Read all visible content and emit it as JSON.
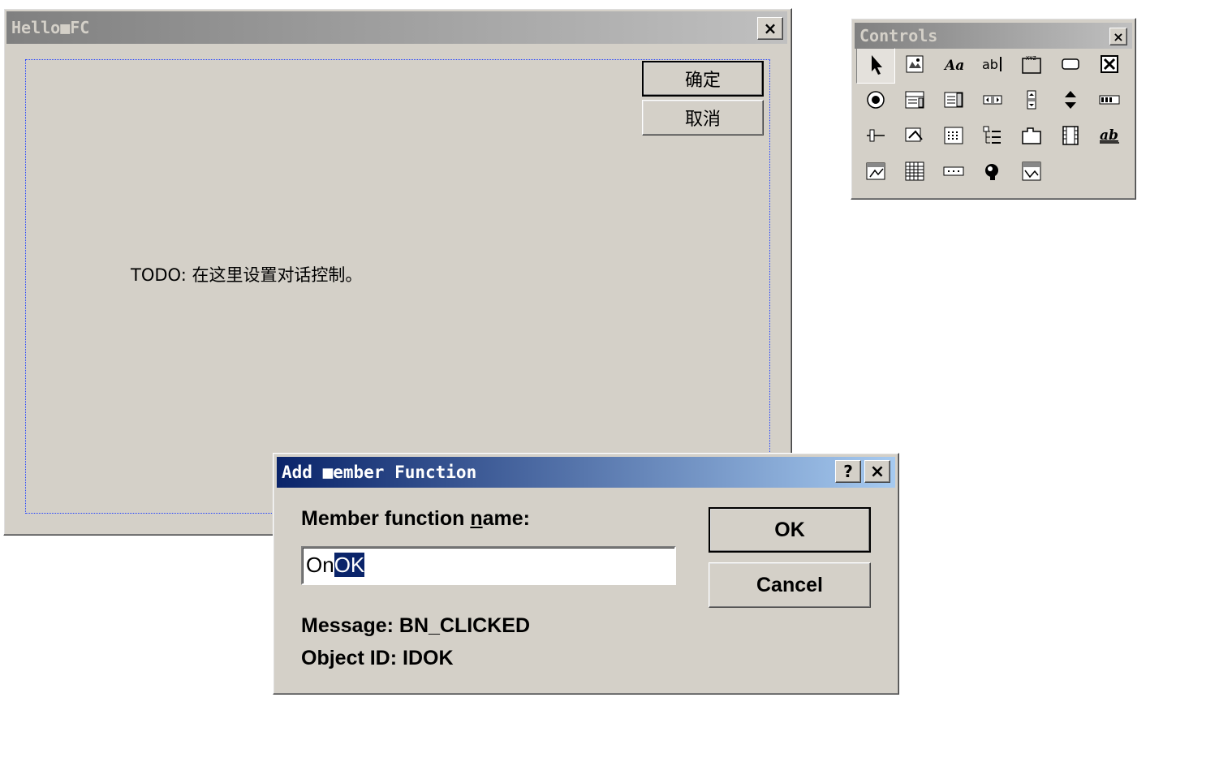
{
  "dialog_editor": {
    "title": "Hello■FC",
    "ok_button": "确定",
    "cancel_button": "取消",
    "static_text": "TODO: 在这里设置对话控制。"
  },
  "controls_toolbar": {
    "title": "Controls",
    "items": [
      {
        "name": "pointer-icon",
        "glyph": "arrow"
      },
      {
        "name": "picture-icon",
        "glyph": "picture"
      },
      {
        "name": "static-text-icon",
        "glyph": "Aa"
      },
      {
        "name": "edit-box-icon",
        "glyph": "abl"
      },
      {
        "name": "group-box-icon",
        "glyph": "group"
      },
      {
        "name": "button-icon",
        "glyph": "button"
      },
      {
        "name": "check-box-icon",
        "glyph": "check"
      },
      {
        "name": "radio-button-icon",
        "glyph": "radio"
      },
      {
        "name": "combo-box-icon",
        "glyph": "combo"
      },
      {
        "name": "list-box-icon",
        "glyph": "list"
      },
      {
        "name": "horizontal-scrollbar-icon",
        "glyph": "hscroll"
      },
      {
        "name": "vertical-scrollbar-icon",
        "glyph": "vscroll"
      },
      {
        "name": "spin-icon",
        "glyph": "spin"
      },
      {
        "name": "progress-icon",
        "glyph": "progress"
      },
      {
        "name": "slider-icon",
        "glyph": "slider"
      },
      {
        "name": "hotkey-icon",
        "glyph": "hotkey"
      },
      {
        "name": "list-control-icon",
        "glyph": "listctrl"
      },
      {
        "name": "tree-control-icon",
        "glyph": "tree"
      },
      {
        "name": "tab-control-icon",
        "glyph": "tab"
      },
      {
        "name": "animate-icon",
        "glyph": "film"
      },
      {
        "name": "rich-edit-icon",
        "glyph": "ab"
      },
      {
        "name": "date-time-picker-icon",
        "glyph": "datetime"
      },
      {
        "name": "month-calendar-icon",
        "glyph": "calendar"
      },
      {
        "name": "ip-address-icon",
        "glyph": "ip"
      },
      {
        "name": "custom-control-icon",
        "glyph": "custom"
      },
      {
        "name": "extended-combo-icon",
        "glyph": "excombo"
      }
    ]
  },
  "add_member_dialog": {
    "title": "Add ■ember Function",
    "help_label": "?",
    "close_label": "×",
    "name_label_before": "Member function ",
    "name_label_mnemonic": "n",
    "name_label_after": "ame:",
    "input_prefix": "On",
    "input_selected": "OK",
    "message_line": "Message: BN_CLICKED",
    "object_line": "Object ID: IDOK",
    "ok_button": "OK",
    "cancel_button": "Cancel"
  }
}
